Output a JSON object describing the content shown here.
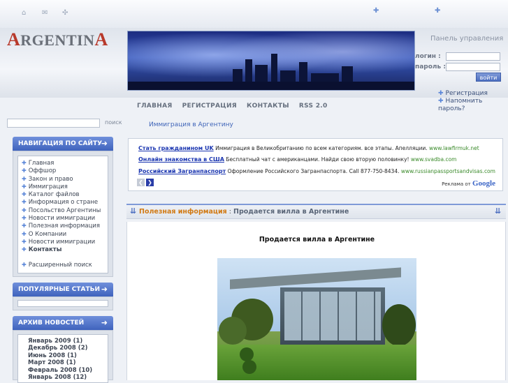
{
  "header": {
    "logo_first": "A",
    "logo_mid": "RGENTIN",
    "logo_last": "A",
    "panel_title": "Панель управления",
    "login_label": "логин :",
    "password_label": "пароль :",
    "login_button": "войти",
    "links": [
      "Регистрация",
      "Напомнить пароль?"
    ],
    "menu": [
      "ГЛАВНАЯ",
      "РЕГИСТРАЦИЯ",
      "КОНТАКТЫ",
      "RSS 2.0"
    ]
  },
  "search": {
    "label": "поиск"
  },
  "breadcrumb": "Иммиграция в Аргентину",
  "nav": {
    "title": "НАВИГАЦИЯ ПО САЙТУ",
    "items": [
      "Главная",
      "Оффшор",
      "Закон и право",
      "Иммиграция",
      "Каталог файлов",
      "Информация о стране",
      "Посольство Аргентины",
      "Новости иммиграции",
      "Полезная информация",
      "О Компании",
      "Новости иммиграции",
      "Контакты"
    ],
    "advanced_search": "Расширенный поиск"
  },
  "popular": {
    "title": "ПОПУЛЯРНЫЕ СТАТЬИ"
  },
  "archive": {
    "title": "АРХИВ НОВОСТЕЙ",
    "items": [
      "Январь 2009 (1)",
      "Декабрь 2008 (2)",
      "Июнь 2008 (1)",
      "Март 2008 (1)",
      "Февраль 2008 (10)",
      "Январь 2008 (12)"
    ]
  },
  "ads": {
    "items": [
      {
        "title": "Стать гражданином UK",
        "text": "Иммиграция в Великобританию по всем категориям. все этапы. Апелляции.",
        "url": "www.lawfirmuk.net"
      },
      {
        "title": "Онлайн знакомства в США",
        "text": "Бесплатный чат с американцами. Найди свою вторую половинку!",
        "url": "www.svadba.com"
      },
      {
        "title": "Российский Загранпаспорт",
        "text": "Оформление Российского Загранпаспорта. Call 877-750-8434.",
        "url": "www.russianpassportsandvisas.com"
      }
    ],
    "google_label": "Реклама от",
    "google_brand": "Google"
  },
  "article": {
    "category": "Полезная информация",
    "separator": ":",
    "heading": "Продается вилла в Аргентине",
    "title": "Продается вилла в Аргентине"
  },
  "colors": {
    "accent": "#4d6fc0",
    "category": "#d17a14",
    "ad_title": "#1a35b0",
    "ad_url": "#3a8a2a"
  }
}
